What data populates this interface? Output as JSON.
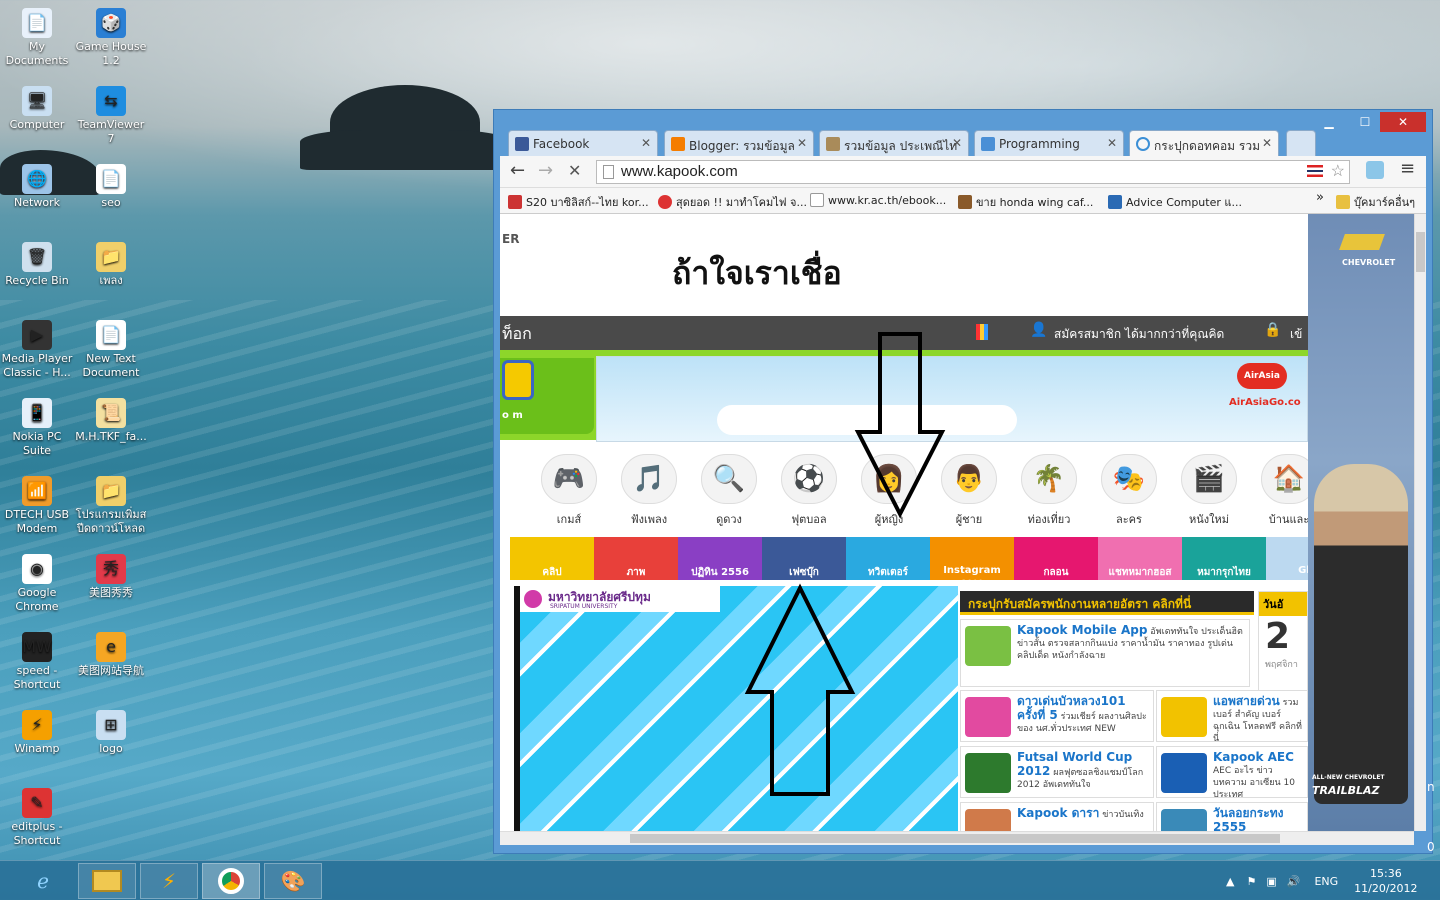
{
  "desktop": {
    "icons": [
      {
        "label": "My Documents"
      },
      {
        "label": "Game House 1.2"
      },
      {
        "label": "Computer"
      },
      {
        "label": "TeamViewer 7"
      },
      {
        "label": "Network"
      },
      {
        "label": "seo"
      },
      {
        "label": "Recycle Bin"
      },
      {
        "label": "เพลง"
      },
      {
        "label": "Media Player Classic - H..."
      },
      {
        "label": "New Text Document"
      },
      {
        "label": "Nokia PC Suite"
      },
      {
        "label": "M.H.TKF_fa..."
      },
      {
        "label": "DTECH USB Modem"
      },
      {
        "label": "โปรแกรมเพิ่มสปีดดาวน์โหลด"
      },
      {
        "label": "Google Chrome"
      },
      {
        "label": "美图秀秀"
      },
      {
        "label": "speed - Shortcut"
      },
      {
        "label": "美图网站导航"
      },
      {
        "label": "Winamp"
      },
      {
        "label": "logo"
      },
      {
        "label": "editplus - Shortcut"
      }
    ]
  },
  "taskbar": {
    "clock_time": "15:36",
    "clock_date": "11/20/2012",
    "lang": "ENG",
    "edge_peek_1": "n",
    "edge_peek_2": "0"
  },
  "browser": {
    "tabs": [
      {
        "label": "Facebook",
        "color": "#3b5998"
      },
      {
        "label": "Blogger: รวมข้อมูล",
        "color": "#f57d00"
      },
      {
        "label": "รวมข้อมูล ประเพณีไท",
        "color": "#a98b5a"
      },
      {
        "label": "Programming",
        "color": "#4a8fd6"
      },
      {
        "label": "กระปุกดอทคอม รวม",
        "color": "#3b8fd6"
      }
    ],
    "url": "www.kapook.com",
    "bookmarks": [
      {
        "label": "S20 บาซิลิสก์--ไทย kor..."
      },
      {
        "label": "สุดยอด !! มาทำโคมไฟ จ..."
      },
      {
        "label": "www.kr.ac.th/ebook..."
      },
      {
        "label": "ขาย honda wing caf..."
      },
      {
        "label": "Advice Computer แ..."
      }
    ],
    "bookmarks_overflow": "»",
    "bookmarks_other": "บุ๊คมาร์คอื่นๆ"
  },
  "kapook": {
    "banner_text": "ถ้าใจเราเชื่อ",
    "nav_left": "ท็อก",
    "register": "สมัครสมาชิก ได้มากกว่าที่คุณคิด",
    "login": "เข้",
    "logo_small": "o m",
    "airasia": "AirAsia",
    "airasia_go": "AirAsiaGo.co",
    "chevrolet": "CHEVROLET",
    "chevy_ad_1": "ALL-NEW CHEVROLET",
    "chevy_ad_2": "TRAILBLAZ",
    "categories": [
      {
        "label": "เกมส์",
        "icon": "🎮"
      },
      {
        "label": "ฟังเพลง",
        "icon": "🎵"
      },
      {
        "label": "ดูดวง",
        "icon": "🔍"
      },
      {
        "label": "ฟุตบอล",
        "icon": "⚽"
      },
      {
        "label": "ผู้หญิง",
        "icon": "👩"
      },
      {
        "label": "ผู้ชาย",
        "icon": "👨"
      },
      {
        "label": "ท่องเที่ยว",
        "icon": "🌴"
      },
      {
        "label": "ละคร",
        "icon": "🎭"
      },
      {
        "label": "หนังใหม่",
        "icon": "🎬"
      },
      {
        "label": "บ้านและ",
        "icon": "🏠"
      }
    ],
    "strips": [
      {
        "label": "คลิป",
        "color": "#f3c500"
      },
      {
        "label": "ภาพ",
        "color": "#e8403a"
      },
      {
        "label": "ปฏิทิน 2556",
        "color": "#8a3fc4"
      },
      {
        "label": "เฟซบุ๊ก",
        "color": "#3b5998"
      },
      {
        "label": "ทวิตเตอร์",
        "color": "#2aa9e0"
      },
      {
        "label": "Instagram ดารา",
        "color": "#f39000"
      },
      {
        "label": "กลอน",
        "color": "#e6176f"
      },
      {
        "label": "แชทหมากฮอส",
        "color": "#f06fb0"
      },
      {
        "label": "หมากรุกไทย",
        "color": "#1aa39a"
      },
      {
        "label": "Glit",
        "color": "#bcd9f0"
      }
    ],
    "university": "มหาวิทยาลัยศรีปทุม",
    "university_en": "SRIPATUM UNIVERSITY",
    "job_banner": "กระปุกรับสมัครพนักงานหลายอัตรา คลิกที่นี่",
    "date_label": "วันอั",
    "date_num": "2",
    "date_sub": "พฤศจิกา",
    "news": [
      {
        "title": "Kapook Mobile App",
        "text": "อัพเดททันใจ ประเด็นฮิต ข่าวสั้น ตรวจสลากกินแบ่ง ราคาน้ำมัน ราคาทอง รูปเด่น คลิปเด็ด หนังกำลังฉาย",
        "color": "#7ac043"
      },
      {
        "title": "ดาวเด่นบัวหลวง101 ครั้งที่ 5",
        "text": "ร่วมเชียร์ ผลงานศิลปะ ของ นศ.ทั่วประเทศ NEW",
        "color": "#e24aa0"
      },
      {
        "title": "แอพสายด่วน",
        "text": "รวมเบอร์ สำคัญ เบอร์ฉุกเฉิน โหลดฟรี คลิกที่นี่",
        "color": "#f2c200"
      },
      {
        "title": "Futsal World Cup 2012",
        "text": "ผลฟุตซอลชิงแชมป์โลก 2012 อัพเดททันใจ",
        "color": "#2d7a2d"
      },
      {
        "title": "Kapook AEC",
        "text": "AEC อะไร ข่าว บทความ อาเซียน 10 ประเทศ",
        "color": "#1a5fb4"
      },
      {
        "title": "Kapook ดารา",
        "text": "ข่าวบันเทิง",
        "color": "#d07a4a"
      },
      {
        "title": "วันลอยกระทง 2555",
        "text": "",
        "color": "#3a8ab8"
      }
    ]
  }
}
